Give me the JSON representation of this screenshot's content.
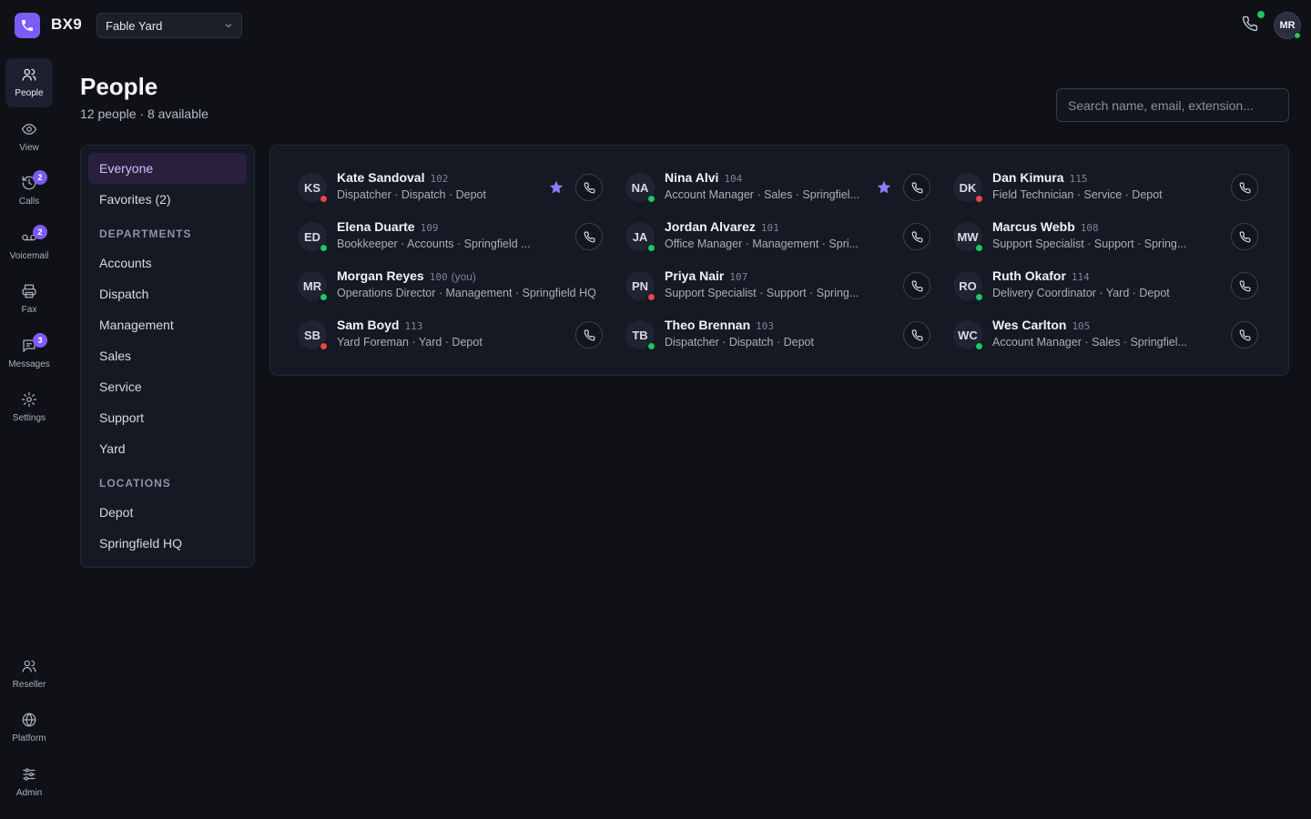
{
  "app": {
    "brand": "BX9",
    "org": "Fable Yard",
    "user_initials": "MR"
  },
  "rail": {
    "top": [
      {
        "label": "People",
        "icon": "people-icon",
        "active": true
      },
      {
        "label": "View",
        "icon": "eye-icon"
      },
      {
        "label": "Calls",
        "icon": "history-icon",
        "badge": "2"
      },
      {
        "label": "Voicemail",
        "icon": "voicemail-icon",
        "badge": "2"
      },
      {
        "label": "Fax",
        "icon": "printer-icon"
      },
      {
        "label": "Messages",
        "icon": "message-icon",
        "badge": "3"
      },
      {
        "label": "Settings",
        "icon": "gear-icon"
      }
    ],
    "bottom": [
      {
        "label": "Reseller",
        "icon": "people-icon"
      },
      {
        "label": "Platform",
        "icon": "globe-icon"
      },
      {
        "label": "Admin",
        "icon": "sliders-icon"
      }
    ]
  },
  "header": {
    "title": "People",
    "subtitle": "12 people · 8 available",
    "search_placeholder": "Search name, email, extension..."
  },
  "filters": {
    "everyone": "Everyone",
    "favorites": "Favorites (2)",
    "departments_heading": "DEPARTMENTS",
    "departments": [
      "Accounts",
      "Dispatch",
      "Management",
      "Sales",
      "Service",
      "Support",
      "Yard"
    ],
    "locations_heading": "LOCATIONS",
    "locations": [
      "Depot",
      "Springfield HQ"
    ]
  },
  "people": [
    {
      "initials": "KS",
      "name": "Kate Sandoval",
      "ext": "102",
      "role": "Dispatcher · Dispatch · Depot",
      "status": "red",
      "favorite": true
    },
    {
      "initials": "NA",
      "name": "Nina Alvi",
      "ext": "104",
      "role": "Account Manager · Sales · Springfiel...",
      "status": "green",
      "favorite": true
    },
    {
      "initials": "DK",
      "name": "Dan Kimura",
      "ext": "115",
      "role": "Field Technician · Service · Depot",
      "status": "red",
      "favorite": false
    },
    {
      "initials": "ED",
      "name": "Elena Duarte",
      "ext": "109",
      "role": "Bookkeeper · Accounts · Springfield ...",
      "status": "green",
      "favorite": false
    },
    {
      "initials": "JA",
      "name": "Jordan Alvarez",
      "ext": "101",
      "role": "Office Manager · Management · Spri...",
      "status": "green",
      "favorite": false
    },
    {
      "initials": "MW",
      "name": "Marcus Webb",
      "ext": "108",
      "role": "Support Specialist · Support · Spring...",
      "status": "green",
      "favorite": false
    },
    {
      "initials": "MR",
      "name": "Morgan Reyes",
      "ext": "100",
      "you": "(you)",
      "role": "Operations Director · Management · Springfield HQ",
      "status": "green",
      "favorite": false
    },
    {
      "initials": "PN",
      "name": "Priya Nair",
      "ext": "107",
      "role": "Support Specialist · Support · Spring...",
      "status": "red",
      "favorite": false
    },
    {
      "initials": "RO",
      "name": "Ruth Okafor",
      "ext": "114",
      "role": "Delivery Coordinator · Yard · Depot",
      "status": "green",
      "favorite": false
    },
    {
      "initials": "SB",
      "name": "Sam Boyd",
      "ext": "113",
      "role": "Yard Foreman · Yard · Depot",
      "status": "red",
      "favorite": false
    },
    {
      "initials": "TB",
      "name": "Theo Brennan",
      "ext": "103",
      "role": "Dispatcher · Dispatch · Depot",
      "status": "green",
      "favorite": false
    },
    {
      "initials": "WC",
      "name": "Wes Carlton",
      "ext": "105",
      "role": "Account Manager · Sales · Springfiel...",
      "status": "green",
      "favorite": false
    }
  ],
  "colors": {
    "accent": "#7c5cf6",
    "available": "#22c55e",
    "busy": "#ef4444",
    "background": "#0f1117"
  }
}
